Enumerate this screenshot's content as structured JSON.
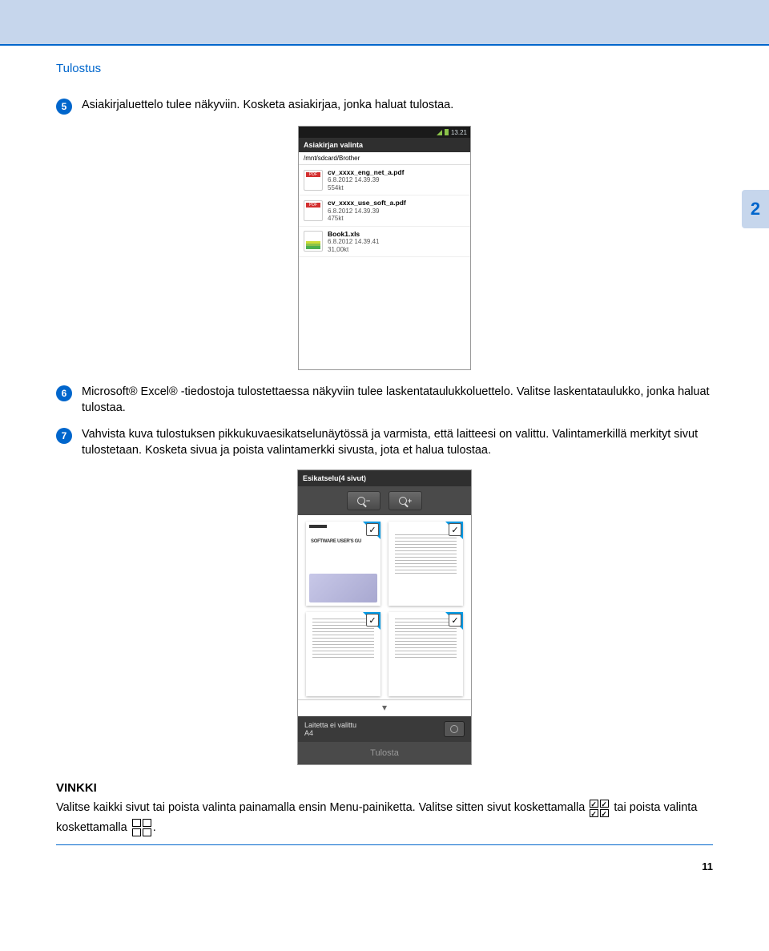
{
  "section_title": "Tulostus",
  "side_tab": "2",
  "steps": {
    "s5": {
      "num": "5",
      "text": "Asiakirjaluettelo tulee näkyviin. Kosketa asiakirjaa, jonka haluat tulostaa."
    },
    "s6": {
      "num": "6",
      "text": "Microsoft® Excel® -tiedostoja tulostettaessa näkyviin tulee laskentataulukkoluettelo. Valitse laskentataulukko, jonka haluat tulostaa."
    },
    "s7": {
      "num": "7",
      "text": "Vahvista kuva tulostuksen pikkukuvaesikatselunäytössä ja varmista, että laitteesi on valittu. Valintamerkillä merkityt sivut tulostetaan. Kosketa sivua ja poista valintamerkki sivusta, jota et halua tulostaa."
    }
  },
  "screenshot1": {
    "status_time": "13.21",
    "title": "Asiakirjan valinta",
    "path": "/mnt/sdcard/Brother",
    "files": [
      {
        "name": "cv_xxxx_eng_net_a.pdf",
        "date": "6.8.2012 14.39.39",
        "size": "554kt",
        "type": "pdf"
      },
      {
        "name": "cv_xxxx_use_soft_a.pdf",
        "date": "6.8.2012 14.39.39",
        "size": "475kt",
        "type": "pdf"
      },
      {
        "name": "Book1.xls",
        "date": "6.8.2012 14.39.41",
        "size": "31,00kt",
        "type": "xls"
      }
    ]
  },
  "screenshot2": {
    "title": "Esikatselu(4 sivut)",
    "device_line1": "Laitetta ei valittu",
    "device_line2": "A4",
    "print_btn": "Tulosta",
    "thumb1_caption": "SOFTWARE USER'S GU"
  },
  "vinkki": {
    "title": "VINKKI",
    "body_a": "Valitse kaikki sivut tai poista valinta painamalla ensin Menu-painiketta. Valitse sitten sivut koskettamalla ",
    "body_b": " tai poista valinta koskettamalla ",
    "body_c": "."
  },
  "page_number": "11"
}
